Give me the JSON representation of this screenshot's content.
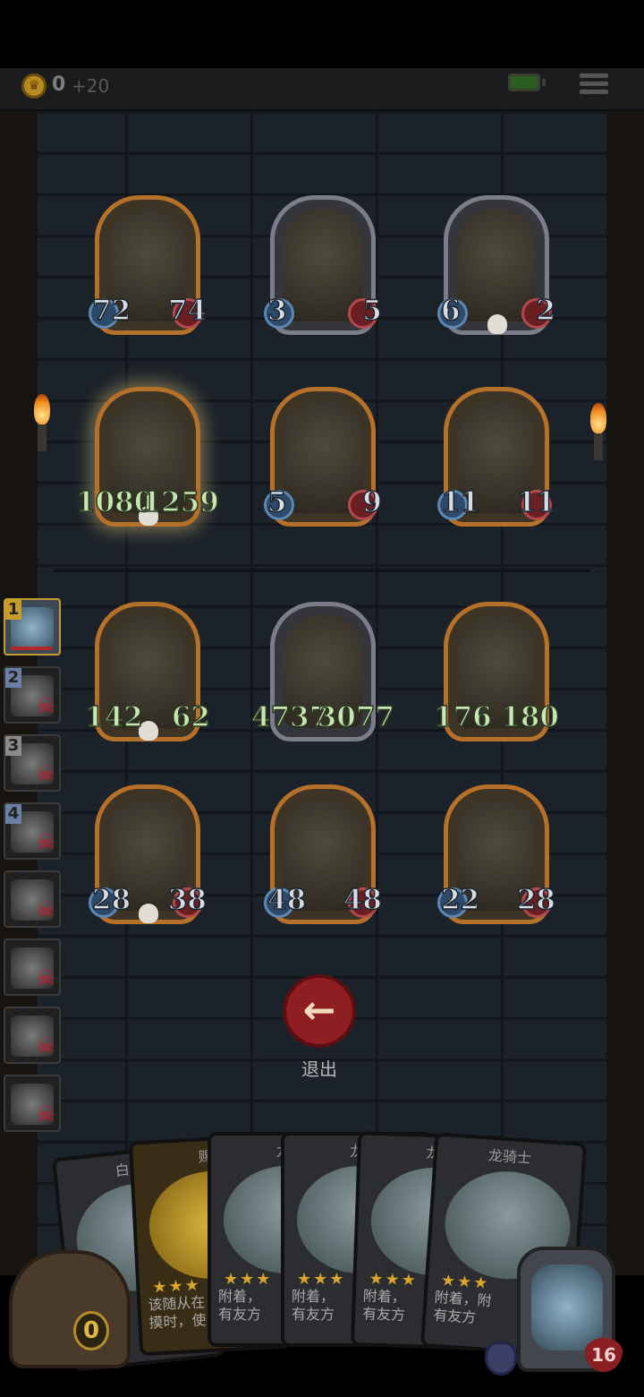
{
  "hud": {
    "coins": "0",
    "coin_bonus": "+20"
  },
  "board": {
    "enemies_top": [
      {
        "atk": "72",
        "hp": "74",
        "frame": "gold",
        "skull": false
      },
      {
        "atk": "3",
        "hp": "5",
        "frame": "gray",
        "skull": false
      },
      {
        "atk": "6",
        "hp": "2",
        "frame": "gray",
        "skull": true
      }
    ],
    "enemies_mid": [
      {
        "atk": "1080",
        "hp": "1259",
        "frame": "gold",
        "skull": true,
        "selected": true
      },
      {
        "atk": "5",
        "hp": "9",
        "frame": "gold",
        "skull": false
      },
      {
        "atk": "11",
        "hp": "11",
        "frame": "gold",
        "skull": false
      }
    ],
    "allies_top": [
      {
        "atk": "142",
        "hp": "62",
        "frame": "gold",
        "skull": true
      },
      {
        "atk": "4737",
        "hp": "3077",
        "frame": "gray",
        "skull": false
      },
      {
        "atk": "176",
        "hp": "180",
        "frame": "gold",
        "skull": false
      }
    ],
    "allies_bottom": [
      {
        "atk": "28",
        "hp": "38",
        "frame": "gold",
        "skull": true
      },
      {
        "atk": "48",
        "hp": "48",
        "frame": "gold",
        "skull": false
      },
      {
        "atk": "22",
        "hp": "28",
        "frame": "gold",
        "skull": false
      }
    ]
  },
  "sidebar": [
    {
      "num": "1",
      "tone": "gold",
      "active": true
    },
    {
      "num": "2",
      "tone": "blue",
      "active": false
    },
    {
      "num": "3",
      "tone": "gray",
      "active": false
    },
    {
      "num": "4",
      "tone": "blue",
      "active": false
    },
    {
      "num": "",
      "tone": "",
      "active": false
    },
    {
      "num": "",
      "tone": "",
      "active": false
    },
    {
      "num": "",
      "tone": "",
      "active": false
    },
    {
      "num": "",
      "tone": "",
      "active": false
    }
  ],
  "exit_label": "退出",
  "hand": [
    {
      "name": "白骨",
      "text": "",
      "tone": "normal"
    },
    {
      "name": "赐",
      "text": "该随从在\n摸时，使",
      "tone": "gold"
    },
    {
      "name": "龙",
      "text": "附着，\n有友方",
      "tone": "normal"
    },
    {
      "name": "龙",
      "text": "附着，\n有友方",
      "tone": "normal"
    },
    {
      "name": "龙",
      "text": "附着，\n有友方",
      "tone": "normal"
    },
    {
      "name": "龙骑士",
      "text": "附着，附\n有友方",
      "tone": "normal"
    }
  ],
  "chest_count": "0",
  "deck_count": "16"
}
